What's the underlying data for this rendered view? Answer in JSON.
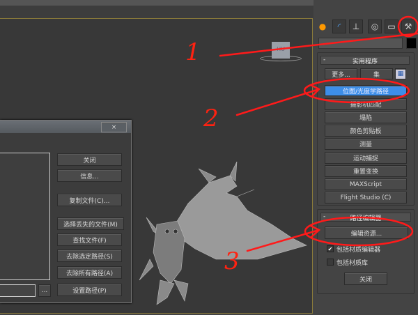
{
  "viewport": {
    "label": "HU"
  },
  "command_panel": {
    "tabs": [
      {
        "icon": "sun-icon"
      },
      {
        "icon": "curve-icon"
      },
      {
        "icon": "hierarchy-icon"
      },
      {
        "icon": "motion-icon"
      },
      {
        "icon": "display-icon"
      },
      {
        "icon": "hammer-icon"
      }
    ],
    "utilities": {
      "title": "实用程序",
      "collapse": "-",
      "more": "更多...",
      "sets": "集",
      "items": [
        "位图/光度学路径",
        "摄影机匹配",
        "塌陷",
        "颜色剪贴板",
        "测量",
        "运动捕捉",
        "重置变换",
        "MAXScript",
        "Flight Studio (C)"
      ],
      "selected_index": 0
    },
    "path_editor": {
      "title": "路径编辑器",
      "collapse": "-",
      "edit_resources": "编辑资源...",
      "include_material_editor": "包括材质编辑器",
      "include_material_editor_checked": true,
      "include_material_library": "包括材质库",
      "include_material_library_checked": false,
      "close": "关闭"
    }
  },
  "dialog": {
    "close_x": "×",
    "buttons": [
      "关闭",
      "信息...",
      "复制文件(C)...",
      "选择丢失的文件(M)",
      "查找文件(F)",
      "去除选定路径(S)",
      "去除所有路径(A)",
      "设置路径(P)"
    ],
    "browse": "...",
    "path_value": ""
  },
  "annotations": [
    "1",
    "2",
    "3"
  ],
  "colors": {
    "accent": "#3d8ee8",
    "annotation": "#ff1a1a"
  }
}
